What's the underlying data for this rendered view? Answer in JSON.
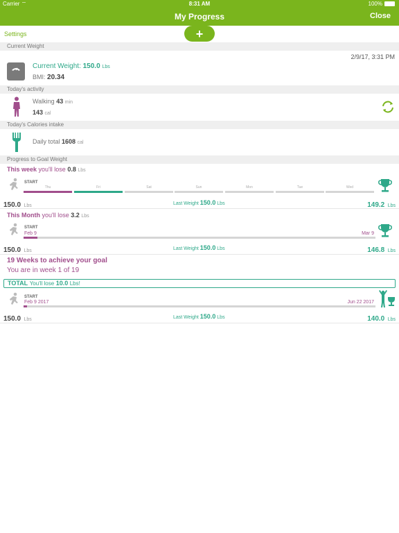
{
  "status": {
    "carrier": "Carrier",
    "time": "8:31 AM",
    "battery": "100%"
  },
  "nav": {
    "title": "My Progress",
    "close": "Close"
  },
  "settings": "Settings",
  "plus": "+",
  "current_weight": {
    "header": "Current Weight",
    "timestamp": "2/9/17, 3:31 PM",
    "label": "Current Weight:",
    "value": "150.0",
    "unit": "Lbs",
    "bmi_label": "BMI:",
    "bmi_value": "20.34"
  },
  "activity": {
    "header": "Today's activity",
    "name": "Walking",
    "minutes": "43",
    "minutes_unit": "min",
    "calories": "143",
    "calories_unit": "cal"
  },
  "intake": {
    "header": "Today's Calories intake",
    "label": "Daily total",
    "value": "1608",
    "unit": "cal"
  },
  "goal_header": "Progress to Goal Weight",
  "week": {
    "title": "This week",
    "lose_text": "you'll lose",
    "amount": "0.8",
    "unit": "Lbs",
    "start": "START",
    "days": [
      "Thu",
      "Fri",
      "Sat",
      "Sun",
      "Mon",
      "Tue",
      "Wed"
    ],
    "start_weight": "150.0",
    "last_weight_label": "Last Weight",
    "last_weight": "150.0",
    "goal_weight": "149.2"
  },
  "month": {
    "title": "This Month",
    "lose_text": "you'll lose",
    "amount": "3.2",
    "unit": "Lbs",
    "start": "START",
    "start_date": "Feb 9",
    "end_date": "Mar 9",
    "progress": 0.03,
    "start_weight": "150.0",
    "last_weight_label": "Last Weight",
    "last_weight": "150.0",
    "goal_weight": "146.8"
  },
  "overall": {
    "weeks_text": "19 Weeks to achieve your goal",
    "week_status": "You are in week 1 of 19",
    "total_label": "TOTAL",
    "total_text": "You'll lose",
    "total_amount": "10.0",
    "total_unit": "Lbs!",
    "start": "START",
    "start_date": "Feb 9 2017",
    "end_date": "Jun 22 2017",
    "progress": 0.01,
    "start_weight": "150.0",
    "last_weight_label": "Last Weight",
    "last_weight": "150.0",
    "goal_weight": "140.0"
  },
  "colors": {
    "brand": "#7ab51d",
    "teal": "#2ea889",
    "purple": "#a14e8c"
  }
}
